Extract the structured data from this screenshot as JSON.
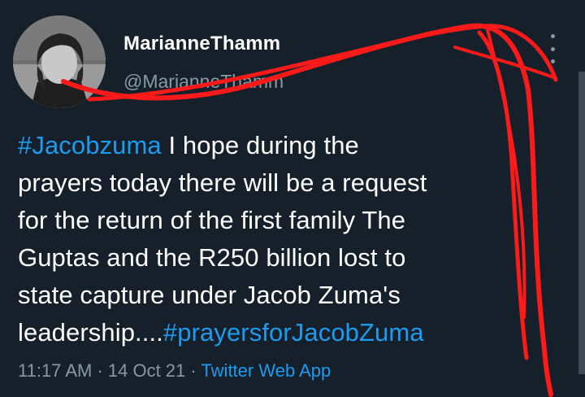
{
  "author": {
    "display_name": "MarianneThamm",
    "handle": "@MarianneThamm"
  },
  "tweet": {
    "lines": [
      {
        "hashtag": "#Jacobzuma",
        "text": " I hope during the"
      },
      {
        "text": "prayers today there will be a request"
      },
      {
        "text": "for the return of the first family The"
      },
      {
        "text": "Guptas and the R250 billion lost to"
      },
      {
        "text": "state capture under Jacob Zuma's"
      },
      {
        "text": "leadership....",
        "hashtag": "#prayersforJacobZuma"
      }
    ]
  },
  "meta": {
    "time": "11:17 AM",
    "separator": " · ",
    "date": "14 Oct 21",
    "source": "Twitter Web App"
  },
  "icons": {
    "more": "more-vertical-icon",
    "avatar": "profile-photo"
  },
  "colors": {
    "background": "#15202b",
    "text": "#ffffff",
    "secondary": "#8899a6",
    "link": "#1d9bf0",
    "scribble": "#ff1a1a"
  }
}
